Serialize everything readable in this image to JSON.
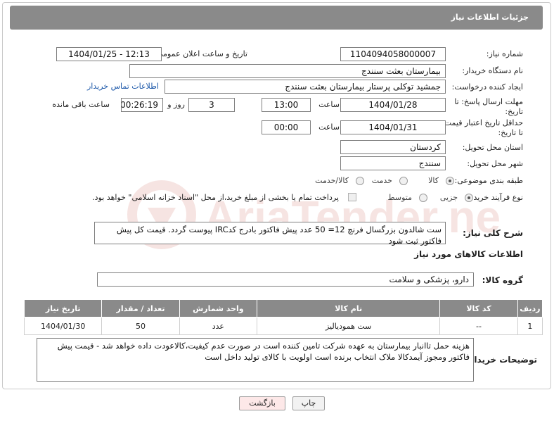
{
  "header": {
    "title": "جزئیات اطلاعات نیاز"
  },
  "fields": {
    "need_number_label": "شماره نیاز:",
    "need_number": "1104094058000007",
    "announce_label": "تاریخ و ساعت اعلان عمومی:",
    "announce_value": "1404/01/25 - 12:13",
    "buyer_org_label": "نام دستگاه خریدار:",
    "buyer_org": "بیمارستان بعثت سنندج",
    "creator_label": "ایجاد کننده درخواست:",
    "creator": "جمشید  توکلی پرستار بیمارستان بعثت سنندج",
    "buyer_contact_link": "اطلاعات تماس خریدار",
    "deadline_label": "مهلت ارسال پاسخ: تا تاریخ:",
    "deadline_date": "1404/01/28",
    "time_label": "ساعت",
    "deadline_time": "13:00",
    "days_value": "3",
    "days_label": "روز و",
    "remaining_value": "00:26:19",
    "remaining_label": "ساعت باقی مانده",
    "min_validity_label": "حداقل تاریخ اعتبار قیمت: تا تاریخ:",
    "validity_date": "1404/01/31",
    "validity_time": "00:00",
    "province_label": "استان محل تحویل:",
    "province": "کردستان",
    "city_label": "شهر محل تحویل:",
    "city": "سنندج",
    "category_label": "طبقه بندی موضوعی:",
    "category_options": [
      "کالا",
      "خدمت",
      "کالا/خدمت"
    ],
    "process_label": "نوع فرآیند خرید :",
    "process_options": [
      "جزیی",
      "متوسط"
    ],
    "treasury_note": "پرداخت تمام یا بخشی از مبلغ خرید،از محل \"اسناد خزانه اسلامی\" خواهد بود."
  },
  "general_description": {
    "label": "شرح کلی نیاز:",
    "text": "ست شالدون بزرگسال فرنچ 12= 50 عدد پیش فاکتور بادرج کدIRC پیوست گردد. قیمت کل پیش فاکتور ثبت شود"
  },
  "goods_section_title": "اطلاعات کالاهای مورد نیاز",
  "goods_group": {
    "label": "گروه کالا:",
    "value": "دارو، پزشکی و سلامت"
  },
  "table": {
    "headers": [
      "ردیف",
      "کد کالا",
      "نام کالا",
      "واحد شمارش",
      "تعداد / مقدار",
      "تاریخ نیاز"
    ],
    "rows": [
      [
        "1",
        "--",
        "ست همودیالیز",
        "عدد",
        "50",
        "1404/01/30"
      ]
    ]
  },
  "buyer_notes": {
    "label": "توضیحات خریدار:",
    "text": "هزینه حمل تاانبار بیمارستان به عهده شرکت تامین کننده است در صورت عدم کیفیت،کالاعودت داده خواهد شد - قیمت پیش فاکتور ومجوز آیمدکالا ملاک انتخاب برنده است اولویت با کالای تولید داخل است"
  },
  "buttons": {
    "print": "چاپ",
    "back": "بازگشت"
  },
  "watermark_text": "AriaTender.neT",
  "colors": {
    "header_bg": "#8a8a8a",
    "link": "#1a56a8",
    "back_button_bg": "#fde8e8",
    "watermark": "#c0392b"
  }
}
